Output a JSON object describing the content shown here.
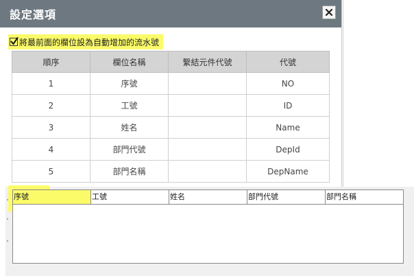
{
  "dialog": {
    "title": "設定選項",
    "close_icon": "close-icon",
    "checkbox": {
      "checked": true,
      "label": "將最前面的欄位設為自動增加的流水號"
    },
    "table": {
      "headers": [
        "順序",
        "欄位名稱",
        "繫結元件代號",
        "代號"
      ],
      "rows": [
        [
          "1",
          "序號",
          "",
          "NO"
        ],
        [
          "2",
          "工號",
          "",
          "ID"
        ],
        [
          "3",
          "姓名",
          "",
          "Name"
        ],
        [
          "4",
          "部門代號",
          "",
          "DepId"
        ],
        [
          "5",
          "部門名稱",
          "",
          "DepName"
        ]
      ]
    }
  },
  "lower_grid": {
    "columns": [
      "序號",
      "工號",
      "姓名",
      "部門代號",
      "部門名稱"
    ]
  },
  "colors": {
    "titlebar": "#6e7881",
    "highlight": "#fbfb6a",
    "header_bg": "#d4d4d4"
  }
}
